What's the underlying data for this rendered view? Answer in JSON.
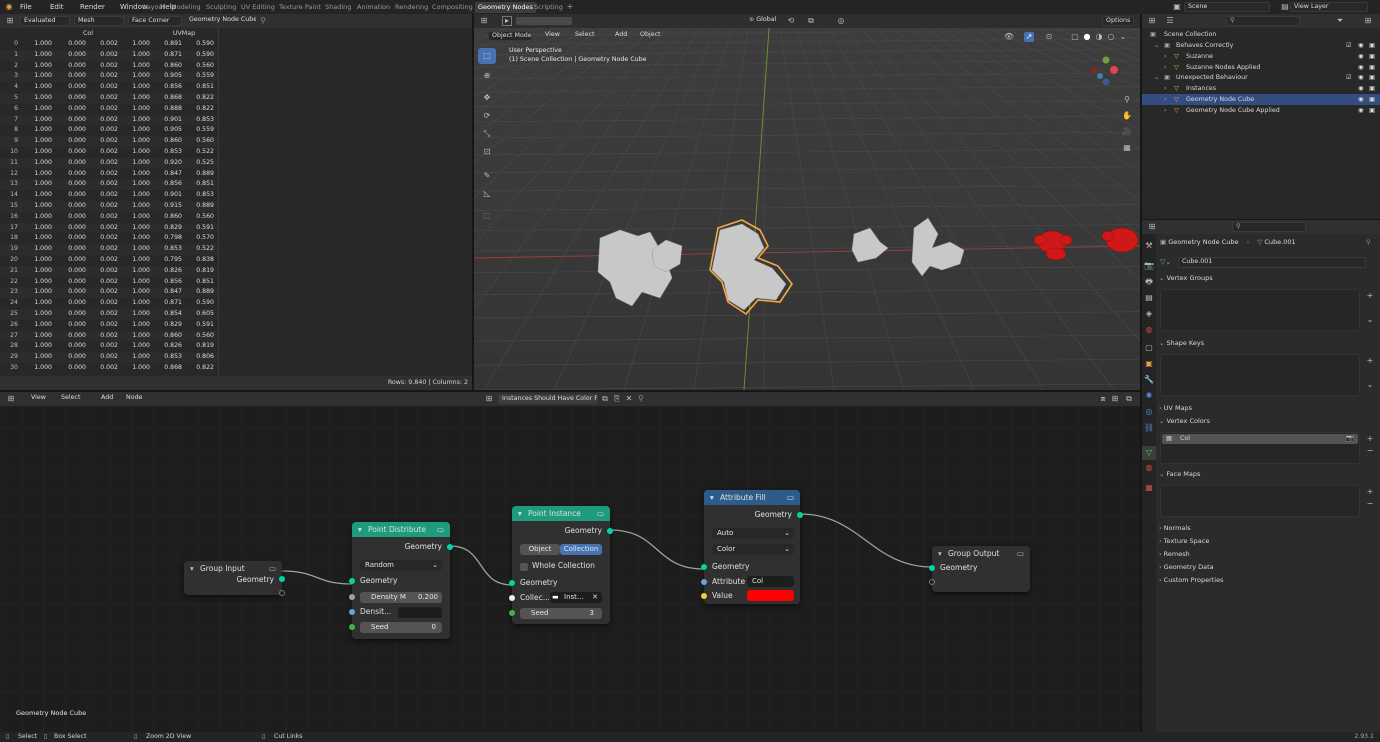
{
  "top_menu": [
    "File",
    "Edit",
    "Render",
    "Window",
    "Help"
  ],
  "workspace_tabs": [
    "Layout",
    "Modeling",
    "Sculpting",
    "UV Editing",
    "Texture Paint",
    "Shading",
    "Animation",
    "Rendering",
    "Compositing",
    "Geometry Nodes",
    "Scripting"
  ],
  "active_workspace": "Geometry Nodes",
  "scene": {
    "name": "Scene",
    "view_layer": "View Layer"
  },
  "spreadsheet": {
    "eval_mode": "Evaluated",
    "domain_type": "Mesh",
    "domain": "Face Corner",
    "object": "Geometry Node Cube",
    "columns": [
      "Col",
      "UVMap"
    ],
    "rows": [
      [
        "0",
        "1.000",
        "0.000",
        "0.002",
        "1.000",
        "0.891",
        "0.590"
      ],
      [
        "1",
        "1.000",
        "0.000",
        "0.002",
        "1.000",
        "0.871",
        "0.590"
      ],
      [
        "2",
        "1.000",
        "0.000",
        "0.002",
        "1.000",
        "0.860",
        "0.560"
      ],
      [
        "3",
        "1.000",
        "0.000",
        "0.002",
        "1.000",
        "0.905",
        "0.559"
      ],
      [
        "4",
        "1.000",
        "0.000",
        "0.002",
        "1.000",
        "0.856",
        "0.851"
      ],
      [
        "5",
        "1.000",
        "0.000",
        "0.002",
        "1.000",
        "0.868",
        "0.822"
      ],
      [
        "6",
        "1.000",
        "0.000",
        "0.002",
        "1.000",
        "0.888",
        "0.822"
      ],
      [
        "7",
        "1.000",
        "0.000",
        "0.002",
        "1.000",
        "0.901",
        "0.853"
      ],
      [
        "8",
        "1.000",
        "0.000",
        "0.002",
        "1.000",
        "0.905",
        "0.559"
      ],
      [
        "9",
        "1.000",
        "0.000",
        "0.002",
        "1.000",
        "0.860",
        "0.560"
      ],
      [
        "10",
        "1.000",
        "0.000",
        "0.002",
        "1.000",
        "0.853",
        "0.522"
      ],
      [
        "11",
        "1.000",
        "0.000",
        "0.002",
        "1.000",
        "0.920",
        "0.525"
      ],
      [
        "12",
        "1.000",
        "0.000",
        "0.002",
        "1.000",
        "0.847",
        "0.889"
      ],
      [
        "13",
        "1.000",
        "0.000",
        "0.002",
        "1.000",
        "0.856",
        "0.851"
      ],
      [
        "14",
        "1.000",
        "0.000",
        "0.002",
        "1.000",
        "0.901",
        "0.853"
      ],
      [
        "15",
        "1.000",
        "0.000",
        "0.002",
        "1.000",
        "0.915",
        "0.889"
      ],
      [
        "16",
        "1.000",
        "0.000",
        "0.002",
        "1.000",
        "0.860",
        "0.560"
      ],
      [
        "17",
        "1.000",
        "0.000",
        "0.002",
        "1.000",
        "0.829",
        "0.591"
      ],
      [
        "18",
        "1.000",
        "0.000",
        "0.002",
        "1.000",
        "0.798",
        "0.570"
      ],
      [
        "19",
        "1.000",
        "0.000",
        "0.002",
        "1.000",
        "0.853",
        "0.522"
      ],
      [
        "20",
        "1.000",
        "0.000",
        "0.002",
        "1.000",
        "0.795",
        "0.838"
      ],
      [
        "21",
        "1.000",
        "0.000",
        "0.002",
        "1.000",
        "0.826",
        "0.819"
      ],
      [
        "22",
        "1.000",
        "0.000",
        "0.002",
        "1.000",
        "0.856",
        "0.851"
      ],
      [
        "23",
        "1.000",
        "0.000",
        "0.002",
        "1.000",
        "0.847",
        "0.889"
      ],
      [
        "24",
        "1.000",
        "0.000",
        "0.002",
        "1.000",
        "0.871",
        "0.590"
      ],
      [
        "25",
        "1.000",
        "0.000",
        "0.002",
        "1.000",
        "0.854",
        "0.605"
      ],
      [
        "26",
        "1.000",
        "0.000",
        "0.002",
        "1.000",
        "0.829",
        "0.591"
      ],
      [
        "27",
        "1.000",
        "0.000",
        "0.002",
        "1.000",
        "0.860",
        "0.560"
      ],
      [
        "28",
        "1.000",
        "0.000",
        "0.002",
        "1.000",
        "0.826",
        "0.819"
      ],
      [
        "29",
        "1.000",
        "0.000",
        "0.002",
        "1.000",
        "0.853",
        "0.806"
      ],
      [
        "30",
        "1.000",
        "0.000",
        "0.002",
        "1.000",
        "0.868",
        "0.822"
      ]
    ],
    "footer": "Rows: 9,840   |   Columns: 2"
  },
  "viewport": {
    "mode": "Object Mode",
    "menus": [
      "View",
      "Select",
      "Add",
      "Object"
    ],
    "orientation": "Global",
    "options": "Options",
    "info_line1": "User Perspective",
    "info_line2": "(1) Scene Collection | Geometry Node Cube"
  },
  "outliner": {
    "root": "Scene Collection",
    "items": [
      {
        "label": "Behaves Correctly",
        "level": 1
      },
      {
        "label": "Suzanne",
        "level": 2
      },
      {
        "label": "Suzanne Nodes Applied",
        "level": 2
      },
      {
        "label": "Unexpected Behaviour",
        "level": 1
      },
      {
        "label": "Instances",
        "level": 2
      },
      {
        "label": "Geometry Node Cube",
        "level": 2,
        "selected": true
      },
      {
        "label": "Geometry Node Cube Applied",
        "level": 2
      }
    ]
  },
  "properties": {
    "object": "Geometry Node Cube",
    "mesh": "Cube.001",
    "mesh_field": "Cube.001",
    "sections": {
      "vertex_groups": "Vertex Groups",
      "shape_keys": "Shape Keys",
      "uv_maps": "UV Maps",
      "vertex_colors": "Vertex Colors",
      "face_maps": "Face Maps"
    },
    "vertex_color_item": "Col",
    "collapsed": [
      "Normals",
      "Texture Space",
      "Remesh",
      "Geometry Data",
      "Custom Properties"
    ]
  },
  "node_editor": {
    "menus": [
      "View",
      "Select",
      "Add",
      "Node"
    ],
    "node_tree": "Instances Should Have Color Filled",
    "footer_label": "Geometry Node Cube",
    "nodes": {
      "group_input": {
        "title": "Group Input",
        "out": "Geometry"
      },
      "point_distribute": {
        "title": "Point Distribute",
        "out": "Geometry",
        "mode": "Random",
        "in_geometry": "Geometry",
        "density_label": "Density M",
        "density_value": "0.200",
        "density_attr": "Densit...",
        "seed_label": "Seed",
        "seed_value": "0"
      },
      "point_instance": {
        "title": "Point Instance",
        "out": "Geometry",
        "btn_object": "Object",
        "btn_collection": "Collection",
        "whole_collection": "Whole Collection",
        "in_geometry": "Geometry",
        "collection_label": "Collec...",
        "collection_value": "Inst...",
        "seed_label": "Seed",
        "seed_value": "3"
      },
      "attribute_fill": {
        "title": "Attribute Fill",
        "out": "Geometry",
        "domain": "Auto",
        "type": "Color",
        "in_geometry": "Geometry",
        "attribute_label": "Attribute",
        "attribute_value": "Col",
        "value_label": "Value",
        "value_color": "#ff0000"
      },
      "group_output": {
        "title": "Group Output",
        "in_geometry": "Geometry"
      }
    }
  },
  "status_bar": {
    "select": "Select",
    "box_select": "Box Select",
    "zoom": "Zoom 2D View",
    "cut": "Cut Links",
    "version": "2.93.1"
  },
  "colors": {
    "accent": "#4772b3",
    "geometry_socket": "#00d6a3",
    "selection_orange": "#f5a742",
    "node_green": "#1e9b7d",
    "node_blue": "#2e5c8a"
  }
}
